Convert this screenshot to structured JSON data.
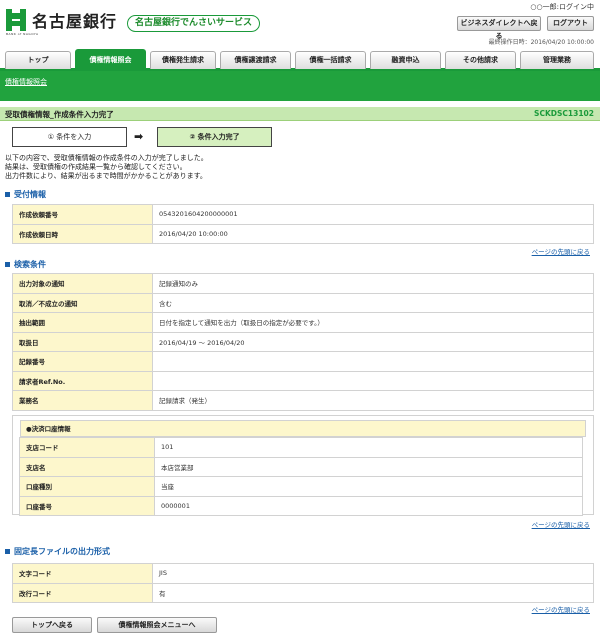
{
  "header": {
    "bank_name": "名古屋銀行",
    "bank_sub": "BANK of NAGOYA",
    "service_name": "名古屋銀行でんさいサービス",
    "user_name": "○○一郎:ログイン中",
    "btn_business": "ビジネスダイレクトへ戻る",
    "btn_logout": "ログアウト",
    "last_operation": "最終操作日時：2016/04/20 10:00:00"
  },
  "tabs": [
    "トップ",
    "債権情報照会",
    "債権発生請求",
    "債権譲渡請求",
    "債権一括請求",
    "融資申込",
    "その他請求",
    "管理業務"
  ],
  "subnav": {
    "link": "債権情報照会"
  },
  "page": {
    "title": "受取債権情報_作成条件入力完了",
    "screen_id": "SCKDSC13102"
  },
  "steps": {
    "step1": "① 条件を入力",
    "step2": "② 条件入力完了",
    "arrow": "➡"
  },
  "message": [
    "以下の内容で、受取債権情報の作成条件の入力が完了しました。",
    "結果は、受取債権の作成結果一覧から確認してください。",
    "出力件数により、結果が出るまで時間がかかることがあります。"
  ],
  "sections": {
    "reception": {
      "title": "受付情報",
      "rows": [
        {
          "k": "作成依頼番号",
          "v": "0543201604200000001"
        },
        {
          "k": "作成依頼日時",
          "v": "2016/04/20 10:00:00"
        }
      ]
    },
    "search": {
      "title": "検索条件",
      "rows": [
        {
          "k": "出力対象の通知",
          "v": "記録通知のみ"
        },
        {
          "k": "取消／不成立の通知",
          "v": "含む"
        },
        {
          "k": "抽出範囲",
          "v": "日付を指定して通知を出力（取扱日の指定が必要です。）"
        },
        {
          "k": "取扱日",
          "v": "2016/04/19 ～ 2016/04/20"
        },
        {
          "k": "記録番号",
          "v": ""
        },
        {
          "k": "請求者Ref.No.",
          "v": ""
        },
        {
          "k": "業務名",
          "v": "記録請求（発生）"
        }
      ],
      "account_title": "●決済口座情報",
      "account_rows": [
        {
          "k": "支店コード",
          "v": "101"
        },
        {
          "k": "支店名",
          "v": "本店営業部"
        },
        {
          "k": "口座種別",
          "v": "当座"
        },
        {
          "k": "口座番号",
          "v": "0000001"
        }
      ]
    },
    "fixed": {
      "title": "固定長ファイルの出力形式",
      "rows": [
        {
          "k": "文字コード",
          "v": "JIS"
        },
        {
          "k": "改行コード",
          "v": "有"
        }
      ]
    }
  },
  "back_to_top": "ページの先頭に戻る",
  "bottom": {
    "btn_top": "トップへ戻る",
    "btn_menu": "債権情報照会メニューへ"
  },
  "colors": {
    "green": "#1a9a3a",
    "light_green": "#c6e8b0",
    "key_bg": "#fdf7cc",
    "link_blue": "#1a5fa8"
  }
}
